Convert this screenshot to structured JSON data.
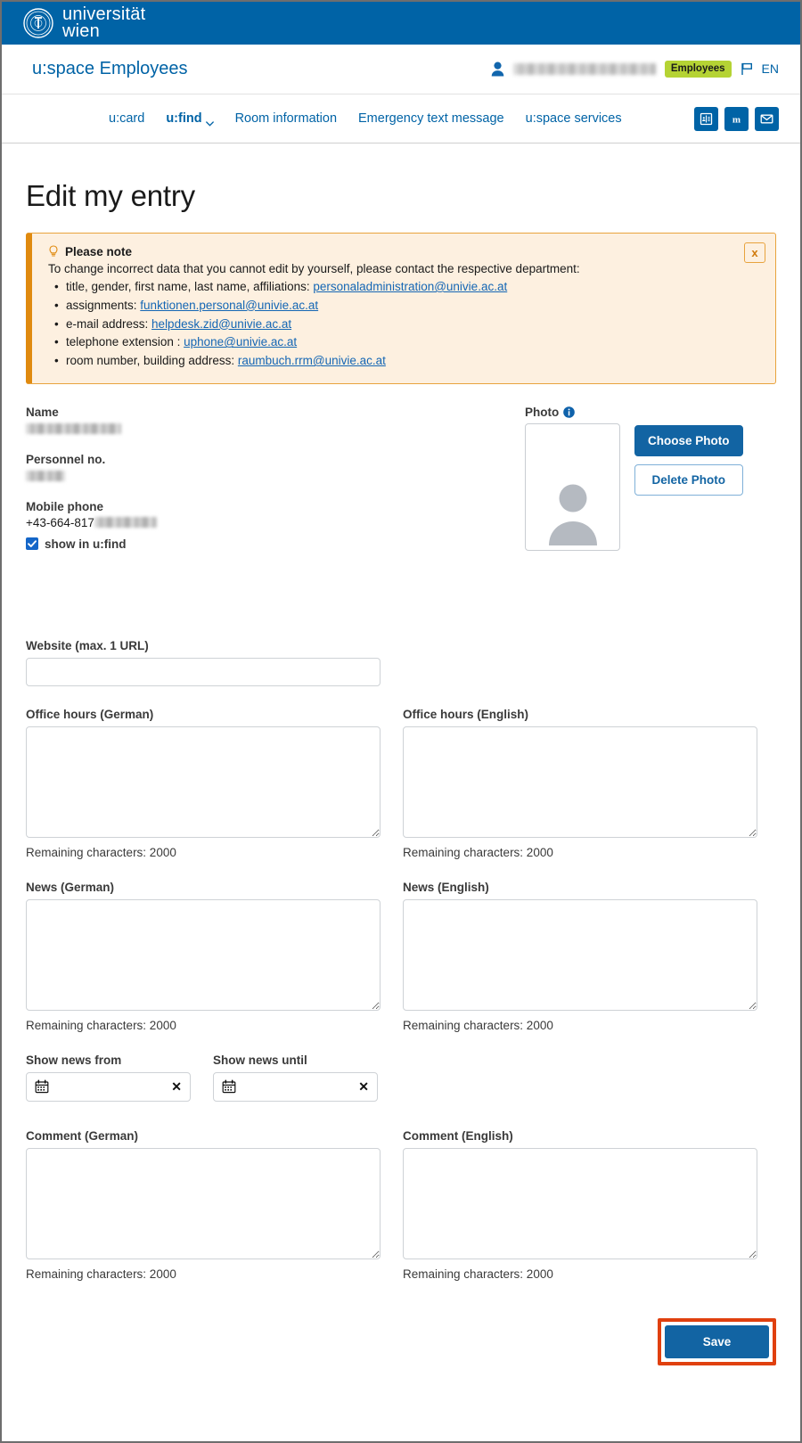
{
  "brand": {
    "name_line1": "universität",
    "name_line2": "wien",
    "seal_icon": "university-seal-icon"
  },
  "header": {
    "app_title": "u:space Employees",
    "user_icon": "user-icon",
    "user_name": "",
    "role_badge": "Employees",
    "flag_icon": "flag-icon",
    "language": "EN"
  },
  "nav": {
    "items": [
      {
        "label": "u:card",
        "active": false,
        "has_caret": false
      },
      {
        "label": "u:find",
        "active": true,
        "has_caret": true
      },
      {
        "label": "Room information",
        "active": false,
        "has_caret": false
      },
      {
        "label": "Emergency text message",
        "active": false,
        "has_caret": false
      },
      {
        "label": "u:space services",
        "active": false,
        "has_caret": false
      }
    ],
    "icons": [
      {
        "name": "address-book-icon"
      },
      {
        "name": "moodle-icon"
      },
      {
        "name": "envelope-mail-icon"
      }
    ]
  },
  "page": {
    "title": "Edit my entry"
  },
  "notice": {
    "icon": "lightbulb-icon",
    "heading": "Please note",
    "intro": "To change incorrect data that you cannot edit by yourself, please contact the respective department:",
    "close_label": "x",
    "items": [
      {
        "text": "title, gender, first name, last name, affiliations: ",
        "link": "personaladministration@univie.ac.at"
      },
      {
        "text": "assignments: ",
        "link": "funktionen.personal@univie.ac.at"
      },
      {
        "text": "e-mail address: ",
        "link": "helpdesk.zid@univie.ac.at"
      },
      {
        "text": "telephone extension : ",
        "link": "uphone@univie.ac.at"
      },
      {
        "text": "room number, building address: ",
        "link": "raumbuch.rrm@univie.ac.at"
      }
    ]
  },
  "personal": {
    "name_label": "Name",
    "name_value": "",
    "personnel_label": "Personnel no.",
    "personnel_value": "",
    "mobile_label": "Mobile phone",
    "mobile_value": "+43-664-817",
    "show_in_ufind_label": "show in u:find",
    "show_in_ufind_checked": true
  },
  "photo": {
    "label": "Photo",
    "info_icon": "info-circle-icon",
    "placeholder_icon": "person-placeholder-icon",
    "choose_label": "Choose Photo",
    "delete_label": "Delete Photo"
  },
  "form": {
    "website": {
      "label": "Website (max. 1 URL)",
      "value": "",
      "placeholder": ""
    },
    "office_hours_de": {
      "label": "Office hours (German)",
      "value": "",
      "remaining": "Remaining characters: 2000"
    },
    "office_hours_en": {
      "label": "Office hours (English)",
      "value": "",
      "remaining": "Remaining characters: 2000"
    },
    "news_de": {
      "label": "News (German)",
      "value": "",
      "remaining": "Remaining characters: 2000"
    },
    "news_en": {
      "label": "News (English)",
      "value": "",
      "remaining": "Remaining characters: 2000"
    },
    "show_news_from": {
      "label": "Show news from",
      "value": "",
      "calendar_icon": "calendar-icon",
      "clear_icon": "✕"
    },
    "show_news_until": {
      "label": "Show news until",
      "value": "",
      "calendar_icon": "calendar-icon",
      "clear_icon": "✕"
    },
    "comment_de": {
      "label": "Comment (German)",
      "value": "",
      "remaining": "Remaining characters: 2000"
    },
    "comment_en": {
      "label": "Comment (English)",
      "value": "",
      "remaining": "Remaining characters: 2000"
    },
    "save_label": "Save"
  },
  "colors": {
    "brand_blue": "#0063a6",
    "link_blue": "#1466b4",
    "button_blue": "#1264a3",
    "badge_green": "#b5d334",
    "notice_bg": "#fdf0e0",
    "notice_border": "#e08a0f",
    "highlight_red": "#e0400f"
  }
}
